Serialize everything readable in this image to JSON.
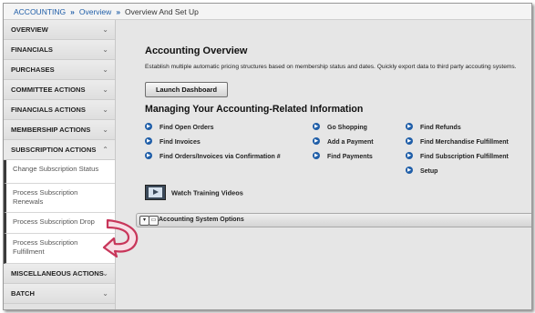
{
  "breadcrumb": {
    "items": [
      "ACCOUNTING",
      "Overview"
    ],
    "separator": "»",
    "current": "Overview And Set Up"
  },
  "sidebar": {
    "chevron_closed": "⌄",
    "chevron_open": "⌃",
    "sections_top": [
      {
        "label": "OVERVIEW"
      },
      {
        "label": "FINANCIALS"
      },
      {
        "label": "PURCHASES"
      },
      {
        "label": "COMMITTEE ACTIONS"
      },
      {
        "label": "FINANCIALS ACTIONS"
      },
      {
        "label": "MEMBERSHIP ACTIONS"
      }
    ],
    "open_section": {
      "label": "SUBSCRIPTION ACTIONS",
      "items": [
        {
          "label": "Change Subscription Status"
        },
        {
          "label": "Process Subscription Renewals"
        },
        {
          "label": "Process Subscription Drop"
        },
        {
          "label": "Process Subscription Fulfillment"
        }
      ]
    },
    "sections_bottom": [
      {
        "label": "MISCELLANEOUS ACTIONS"
      },
      {
        "label": "BATCH"
      }
    ]
  },
  "main": {
    "title": "Accounting Overview",
    "description": "Establish multiple automatic pricing structures based on membership status and dates. Quickly export data to third party accouting systems.",
    "launch_button": "Launch Dashboard",
    "section_title": "Managing Your Accounting-Related Information",
    "links": {
      "col1": [
        "Find Open Orders",
        "Find Invoices",
        "Find Orders/Invoices via Confirmation #"
      ],
      "col2": [
        "Go Shopping",
        "Add a Payment",
        "Find Payments"
      ],
      "col3": [
        "Find Refunds",
        "Find Merchandise Fulfillment",
        "Find Subscription Fulfillment",
        "Setup"
      ]
    },
    "bullet_icon": "arrow-circle-icon",
    "video_link": "Watch Training Videos",
    "options_bar": {
      "label": "Accounting System Options",
      "expand_glyph": "▾",
      "window_glyph": "▭"
    }
  },
  "colors": {
    "link_blue": "#1f5ea8",
    "callout_arrow": "#c8365a"
  }
}
